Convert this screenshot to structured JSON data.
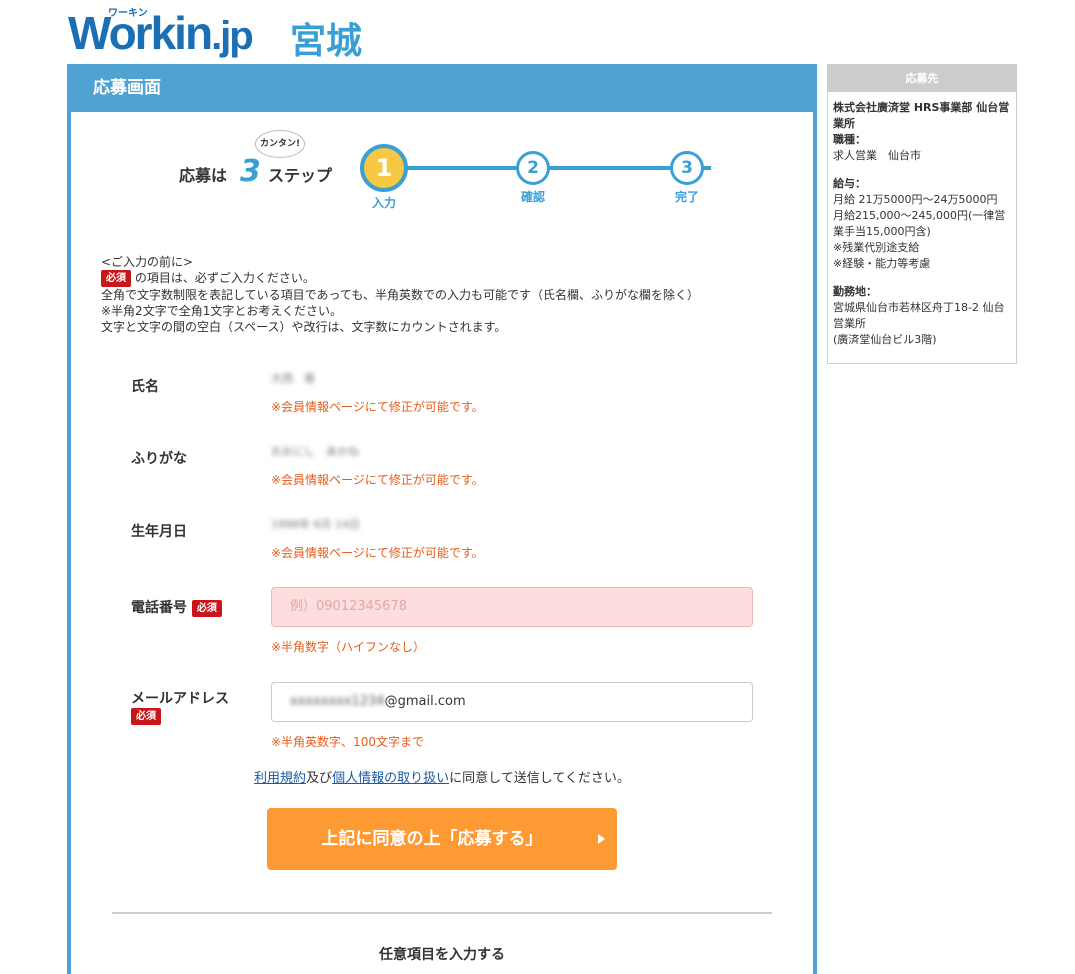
{
  "logo": {
    "brand_main": "Workin",
    "brand_suffix": ".jp",
    "brand_kana": "ワーキン",
    "region": "宮城"
  },
  "main": {
    "title": "応募画面",
    "steps": {
      "title_prefix": "応募は",
      "num": "3",
      "title_suffix": "ステップ",
      "bubble": "カンタン!",
      "items": [
        {
          "num": "1",
          "label": "入力"
        },
        {
          "num": "2",
          "label": "確認"
        },
        {
          "num": "3",
          "label": "完了"
        }
      ]
    },
    "notes": {
      "heading": "<ご入力の前に>",
      "req_badge": "必須",
      "line1": "の項目は、必ずご入力ください。",
      "line2": "全角で文字数制限を表記している項目であっても、半角英数での入力も可能です（氏名欄、ふりがな欄を除く）",
      "line3": "※半角2文字で全角1文字とお考えください。",
      "line4": "文字と文字の間の空白（スペース）や改行は、文字数にカウントされます。"
    },
    "fields": {
      "name": {
        "label": "氏名",
        "value": "大西　香",
        "hint": "※会員情報ページにて修正が可能です。"
      },
      "furigana": {
        "label": "ふりがな",
        "value": "おおにし　あかね",
        "hint": "※会員情報ページにて修正が可能です。"
      },
      "birthday": {
        "label": "生年月日",
        "value": "1998年 6月 14日",
        "hint": "※会員情報ページにて修正が可能です。"
      },
      "phone": {
        "label": "電話番号",
        "required": "必須",
        "placeholder": "例）09012345678",
        "hint": "※半角数字（ハイフンなし）"
      },
      "email": {
        "label": "メールアドレス",
        "required": "必須",
        "value_hidden": "xxxxxxxx1234",
        "value_domain": "@gmail.com",
        "hint": "※半角英数字、100文字まで"
      }
    },
    "agree": {
      "terms": "利用規約",
      "and": "及び",
      "privacy": "個人情報の取り扱い",
      "rest": "に同意して送信してください。"
    },
    "submit_label": "上記に同意の上「応募する」",
    "optional_label": "任意項目を入力する"
  },
  "side": {
    "title": "応募先",
    "company": "株式会社廣済堂 HRS事業部 仙台営業所",
    "job_label": "職種：",
    "job_value": "求人営業　仙台市",
    "salary_label": "給与：",
    "salary_lines": [
      "月給 21万5000円〜24万5000円",
      "月給215,000〜245,000円(一律営業手当15,000円含)",
      "※残業代別途支給",
      "※経験・能力等考慮"
    ],
    "location_label": "勤務地：",
    "location_lines": [
      "宮城県仙台市若林区舟丁18-2 仙台営業所",
      "(廣済堂仙台ビル3階)"
    ]
  },
  "colors": {
    "brand_blue": "#1a6fb5",
    "panel_blue": "#4ea3d3",
    "required_red": "#c8161d",
    "hint_orange": "#e55d1c",
    "submit_orange": "#fe9a33",
    "step_yellow": "#f7c843"
  }
}
